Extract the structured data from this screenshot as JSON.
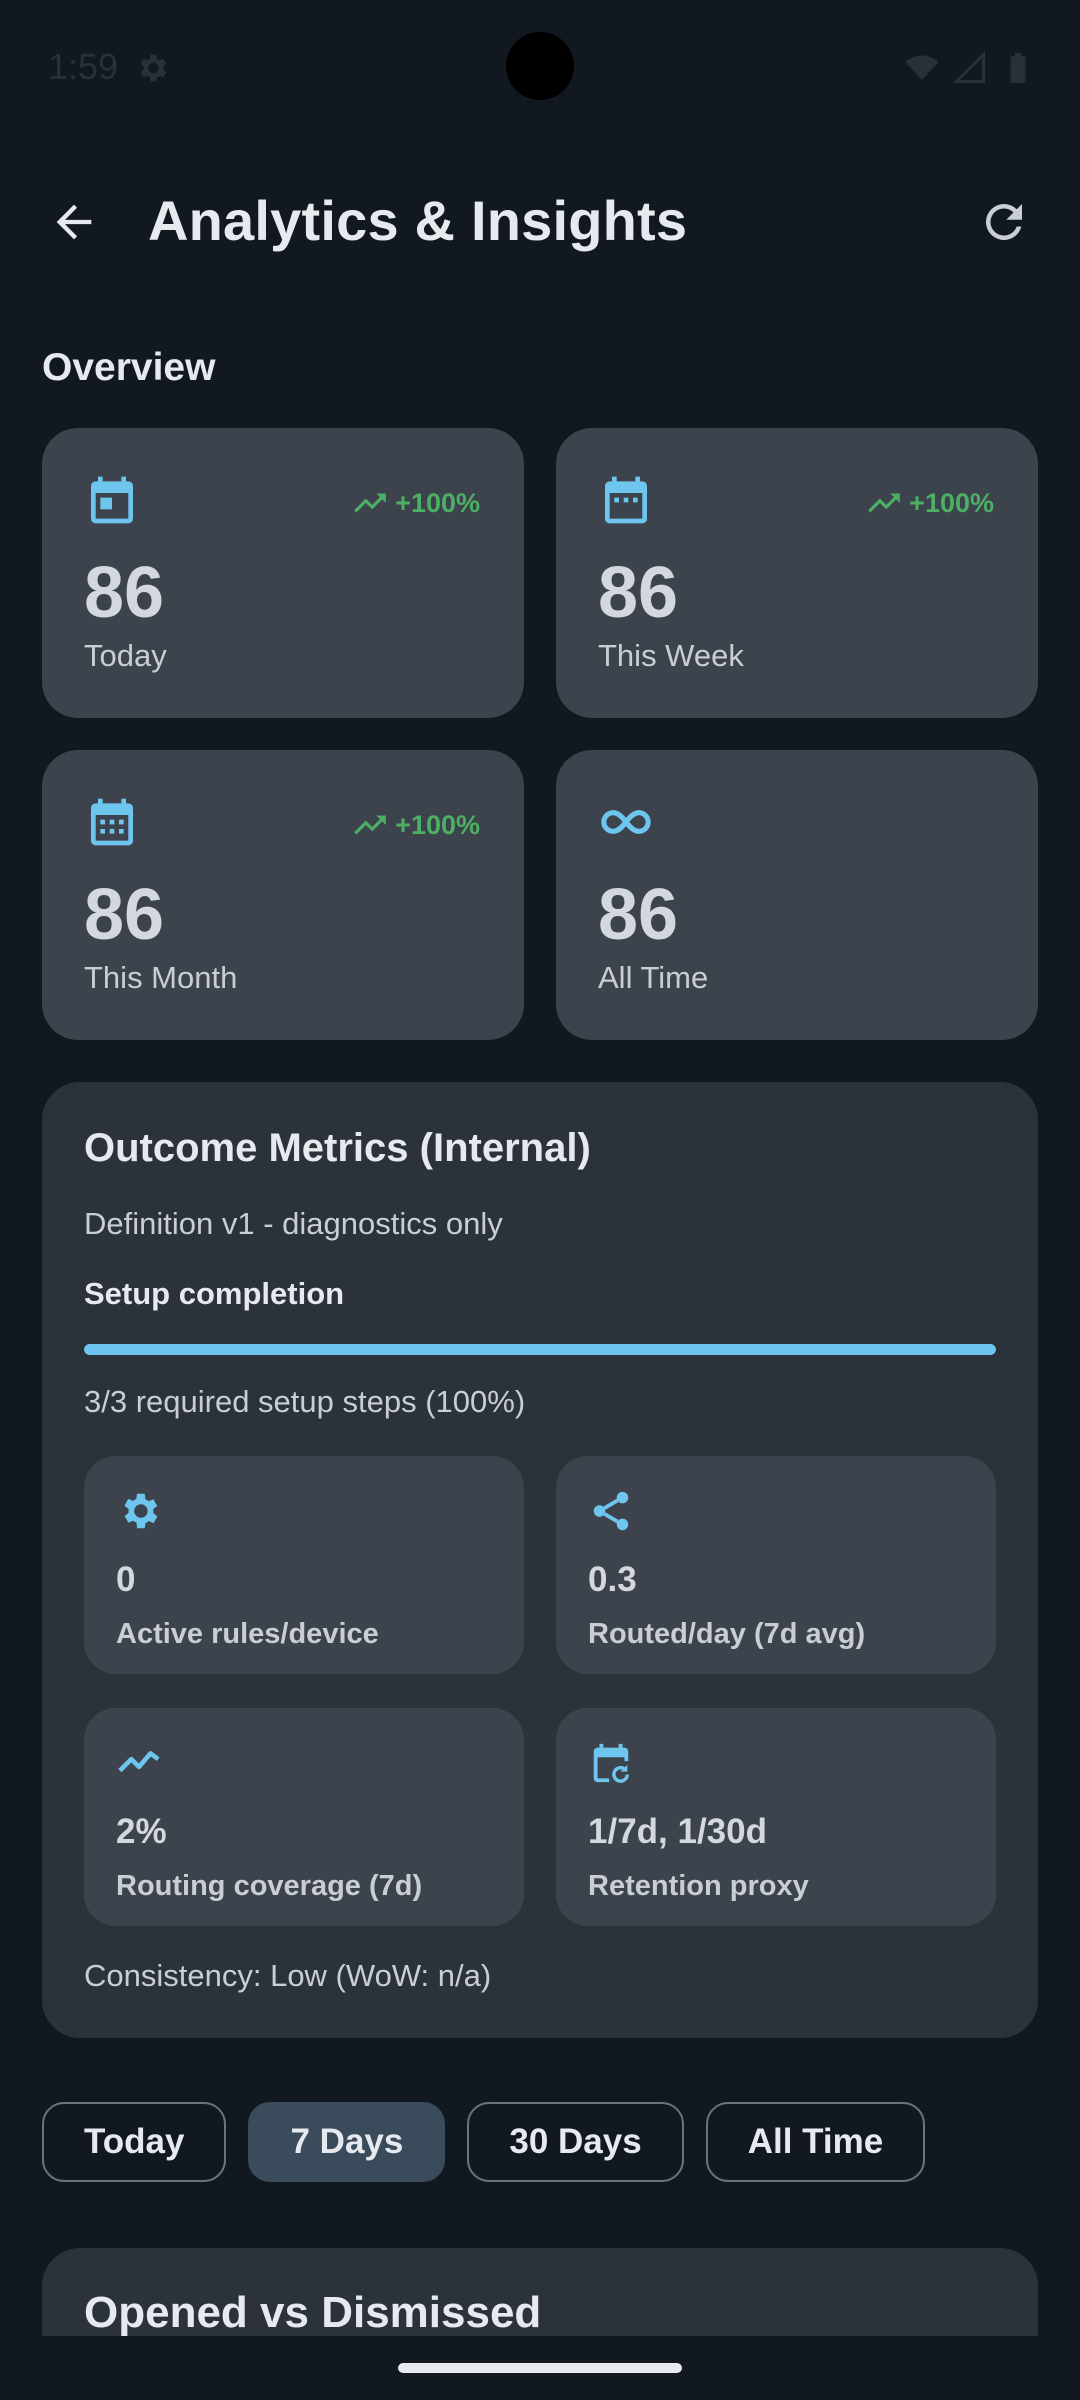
{
  "status_bar": {
    "time": "1:59",
    "icons": [
      "settings-icon",
      "wifi-icon",
      "signal-icon",
      "battery-icon"
    ]
  },
  "app_bar": {
    "back_icon": "arrow-back-icon",
    "title": "Analytics & Insights",
    "refresh_icon": "refresh-icon"
  },
  "overview": {
    "title": "Overview",
    "cards": [
      {
        "icon": "calendar-today-icon",
        "trend": "+100%",
        "value": "86",
        "label": "Today"
      },
      {
        "icon": "calendar-week-icon",
        "trend": "+100%",
        "value": "86",
        "label": "This Week"
      },
      {
        "icon": "calendar-month-icon",
        "trend": "+100%",
        "value": "86",
        "label": "This Month"
      },
      {
        "icon": "infinity-icon",
        "trend": "",
        "value": "86",
        "label": "All Time"
      }
    ]
  },
  "outcome": {
    "title": "Outcome Metrics (Internal)",
    "subtitle": "Definition v1 - diagnostics only",
    "setup_label": "Setup completion",
    "progress_fraction": 1.0,
    "progress_text": "3/3 required setup steps (100%)",
    "tiles": [
      {
        "icon": "gear-icon",
        "value": "0",
        "label": "Active rules/device"
      },
      {
        "icon": "share-icon",
        "value": "0.3",
        "label": "Routed/day (7d avg)"
      },
      {
        "icon": "trend-line-icon",
        "value": "2%",
        "label": "Routing coverage (7d)"
      },
      {
        "icon": "calendar-refresh-icon",
        "value": "1/7d, 1/30d",
        "label": "Retention proxy"
      }
    ],
    "consistency": "Consistency: Low (WoW: n/a)"
  },
  "period_chips": {
    "options": [
      "Today",
      "7 Days",
      "30 Days",
      "All Time"
    ],
    "selected": "7 Days"
  },
  "next_section": {
    "title": "Opened vs Dismissed"
  },
  "colors": {
    "background": "#111820",
    "card": "#3d434c",
    "panel": "#2c323a",
    "accent": "#6ec6ef",
    "trend_green": "#4caf63",
    "selected_chip": "#3a4b5b"
  }
}
